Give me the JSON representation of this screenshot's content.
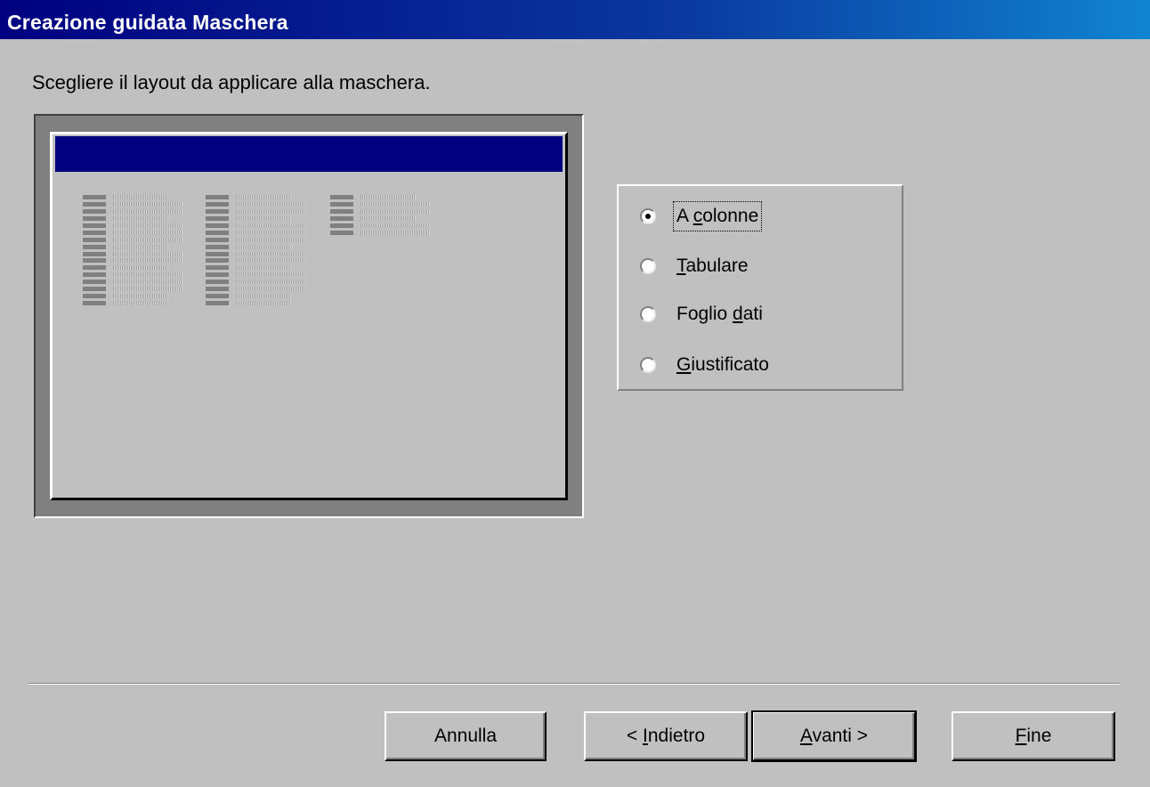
{
  "window": {
    "title": "Creazione guidata Maschera"
  },
  "instruction": "Scegliere il layout da applicare alla maschera.",
  "layout_options": [
    {
      "label_pre": "A ",
      "accel": "c",
      "label_post": "olonne",
      "checked": true
    },
    {
      "label_pre": "",
      "accel": "T",
      "label_post": "abulare",
      "checked": false
    },
    {
      "label_pre": "Foglio ",
      "accel": "d",
      "label_post": "ati",
      "checked": false
    },
    {
      "label_pre": "",
      "accel": "G",
      "label_post": "iustificato",
      "checked": false
    }
  ],
  "buttons": {
    "cancel": {
      "label": "Annulla"
    },
    "back": {
      "label_pre": "< ",
      "accel": "I",
      "label_post": "ndietro"
    },
    "next": {
      "label_pre": "",
      "accel": "A",
      "label_post": "vanti >"
    },
    "finish": {
      "label_pre": "",
      "accel": "F",
      "label_post": "ine"
    }
  },
  "colors": {
    "title_bar": "#000080",
    "face": "#c0c0c0",
    "preview_header": "#000080"
  }
}
